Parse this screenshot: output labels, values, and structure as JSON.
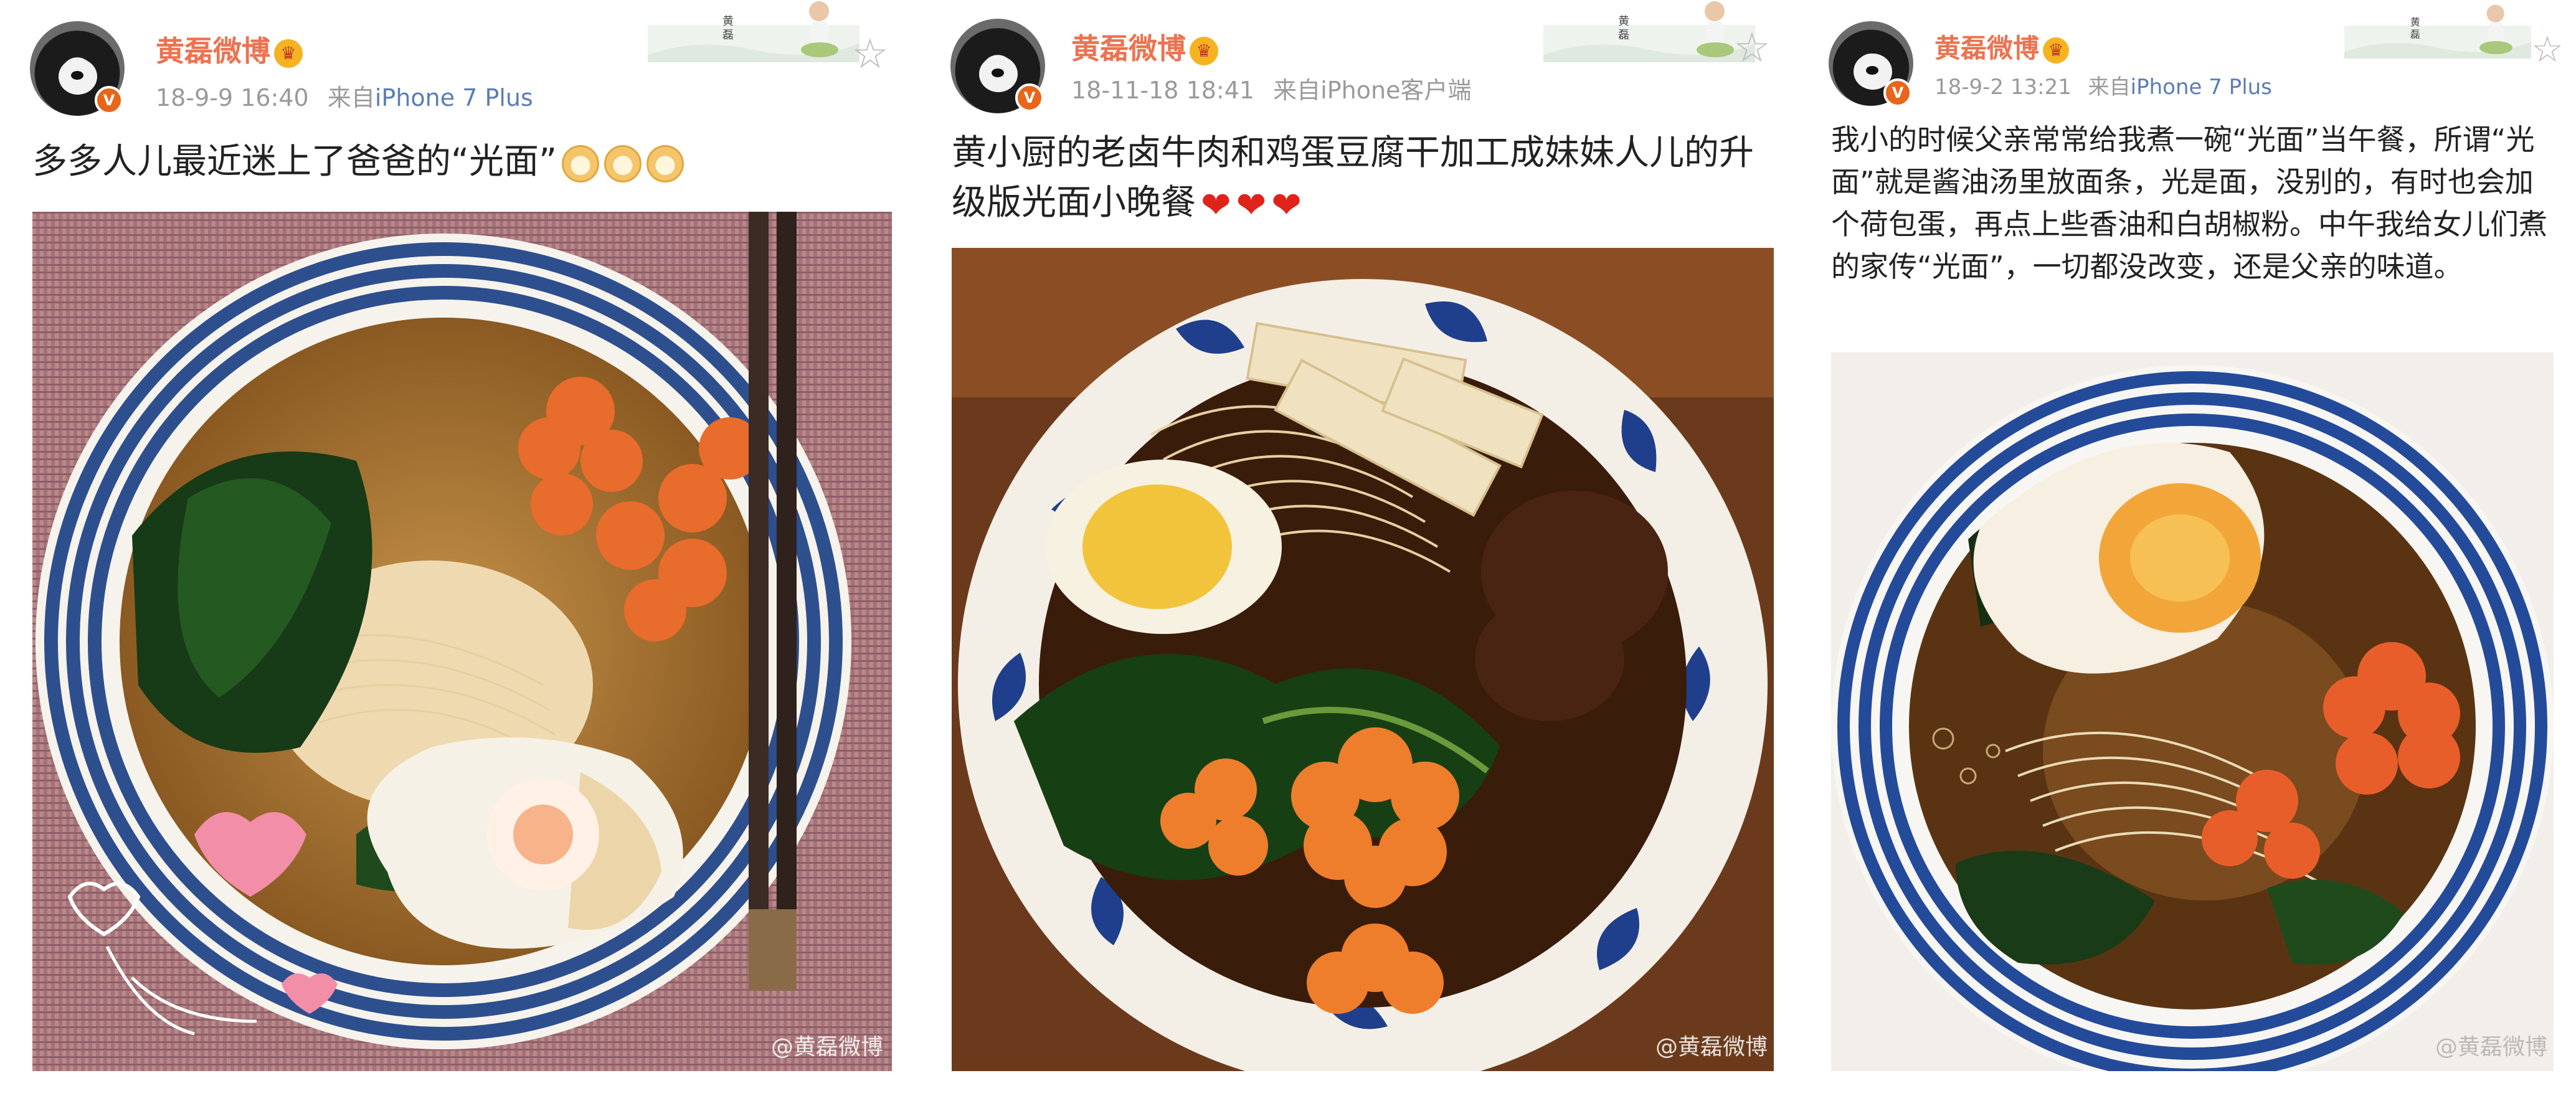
{
  "posts": [
    {
      "user": "黄磊微博",
      "date": "18-9-9 16:40",
      "from": "来自",
      "source": "iPhone 7 Plus",
      "text": "多多人儿最近迷上了爸爸的“光面”",
      "emoji": [
        "doge-emoji",
        "doge-emoji",
        "doge-emoji"
      ],
      "watermark": "@黄磊微博",
      "badge": "V"
    },
    {
      "user": "黄磊微博",
      "date": "18-11-18 18:41",
      "from": "来自",
      "source": "iPhone客户端",
      "text": "黄小厨的老卤牛肉和鸡蛋豆腐干加工成妹妹人儿的升级版光面小晚餐",
      "emoji": [
        "heart-emoji",
        "heart-emoji",
        "heart-emoji"
      ],
      "watermark": "@黄磊微博",
      "badge": "V"
    },
    {
      "user": "黄磊微博",
      "date": "18-9-2 13:21",
      "from": "来自",
      "source": "iPhone 7 Plus",
      "text": "我小的时候父亲常常给我煮一碗“光面”当午餐，所谓“光面”就是酱油汤里放面条，光是面，没别的，有时也会加个荷包蛋，再点上些香油和白胡椒粉。中午我给女儿们煮的家传“光面”，一切都没改变，还是父亲的味道。",
      "watermark": "@黄磊微博",
      "badge": "V"
    }
  ],
  "colors": {
    "username": "#eb7350",
    "meta": "#9a9a9a",
    "source_link": "#5b7db6",
    "badge": "#e8651a"
  },
  "icons": {
    "favorite": "star-outline-icon",
    "verified": "verified-badge-icon",
    "member": "crown-icon"
  }
}
